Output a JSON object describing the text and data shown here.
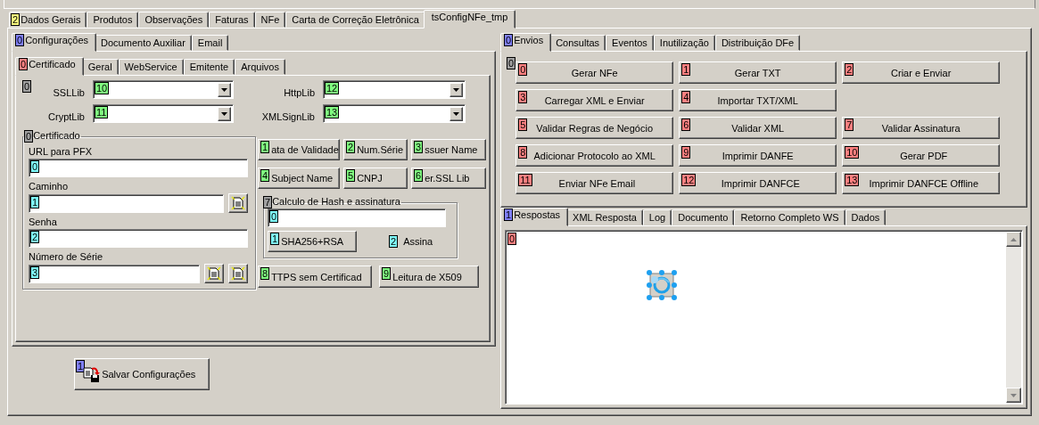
{
  "main_tabs": {
    "badge": {
      "text": "2",
      "color": "#ffff80"
    },
    "items": [
      {
        "label": "Dados Gerais",
        "selected": false
      },
      {
        "label": "Produtos",
        "selected": false
      },
      {
        "label": "Observações",
        "selected": false
      },
      {
        "label": "Faturas",
        "selected": false
      },
      {
        "label": "NFe",
        "selected": false
      },
      {
        "label": "Carta de Correção Eletrônica",
        "selected": false
      },
      {
        "label": "tsConfigNFe_tmp",
        "selected": true
      }
    ]
  },
  "config": {
    "tabs": {
      "badge": {
        "text": "0",
        "color": "#8080ff"
      },
      "items": [
        {
          "label": "Configurações",
          "selected": true
        },
        {
          "label": "Documento Auxiliar",
          "selected": false
        },
        {
          "label": "Email",
          "selected": false
        }
      ]
    },
    "sub_tabs": {
      "badge": {
        "text": "0",
        "color": "#ff8080"
      },
      "items": [
        {
          "label": "Certificado",
          "selected": true
        },
        {
          "label": "Geral",
          "selected": false
        },
        {
          "label": "WebService",
          "selected": false
        },
        {
          "label": "Emitente",
          "selected": false
        },
        {
          "label": "Arquivos",
          "selected": false
        }
      ]
    },
    "panel_badge": {
      "text": "0",
      "color": "#a0a0a0"
    },
    "libs": [
      {
        "label": "SSLLib",
        "badge": {
          "text": "10",
          "color": "#80ff80"
        }
      },
      {
        "label": "HttpLib",
        "badge": {
          "text": "12",
          "color": "#80ff80"
        }
      },
      {
        "label": "CryptLib",
        "badge": {
          "text": "11",
          "color": "#80ff80"
        }
      },
      {
        "label": "XMLSignLib",
        "badge": {
          "text": "13",
          "color": "#80ff80"
        }
      }
    ],
    "certificate": {
      "badge": {
        "text": "0",
        "color": "#a0a0a0"
      },
      "title": "Certificado",
      "fields": [
        {
          "label": "URL para PFX",
          "badge": {
            "text": "0",
            "color": "#80ffff"
          }
        },
        {
          "label": "Caminho",
          "badge": {
            "text": "1",
            "color": "#80ffff"
          },
          "actions": [
            {
              "kind": "browse"
            }
          ]
        },
        {
          "label": "Senha",
          "badge": {
            "text": "2",
            "color": "#80ffff"
          }
        },
        {
          "label": "Número de Série",
          "badge": {
            "text": "3",
            "color": "#80ffff"
          },
          "actions": [
            {
              "kind": "browse"
            },
            {
              "kind": "browse"
            }
          ]
        }
      ]
    },
    "cert_buttons": [
      [
        {
          "label": "ata de Validade",
          "badge": {
            "text": "1",
            "color": "#80ff80"
          }
        },
        {
          "label": "Num.Série",
          "badge": {
            "text": "2",
            "color": "#80ff80"
          }
        },
        {
          "label": "ssuer Name",
          "badge": {
            "text": "3",
            "color": "#80ff80"
          }
        }
      ],
      [
        {
          "label": "Subject Name",
          "badge": {
            "text": "4",
            "color": "#80ff80"
          }
        },
        {
          "label": "CNPJ",
          "badge": {
            "text": "5",
            "color": "#80ff80"
          }
        },
        {
          "label": "er.SSL Lib",
          "badge": {
            "text": "6",
            "color": "#80ff80"
          }
        }
      ]
    ],
    "hash": {
      "badge": {
        "text": "7",
        "color": "#a0a0a0"
      },
      "title": "Calculo de Hash e assinatura",
      "field_badge": {
        "text": "0",
        "color": "#80ffff"
      },
      "algorithm": {
        "label": "SHA256+RSA",
        "badge": {
          "text": "1",
          "color": "#80ffff"
        }
      },
      "sign": {
        "label": "Assina",
        "badge": {
          "text": "2",
          "color": "#80ffff"
        }
      }
    },
    "extra_buttons": [
      {
        "label": "TTPS sem Certificad",
        "badge": {
          "text": "8",
          "color": "#80ff80"
        }
      },
      {
        "label": "Leitura de X509",
        "badge": {
          "text": "9",
          "color": "#80ff80"
        }
      }
    ],
    "save_button": {
      "label": "Salvar Configurações",
      "badge": {
        "text": "1",
        "color": "#8080ff"
      }
    }
  },
  "actions": {
    "tabs": {
      "badge": {
        "text": "0",
        "color": "#8080ff"
      },
      "items": [
        {
          "label": "Envios",
          "selected": true
        },
        {
          "label": "Consultas",
          "selected": false
        },
        {
          "label": "Eventos",
          "selected": false
        },
        {
          "label": "Inutilização",
          "selected": false
        },
        {
          "label": "Distribuição DFe",
          "selected": false
        }
      ]
    },
    "panel_badge": {
      "text": "0",
      "color": "#a0a0a0"
    },
    "rows": [
      [
        {
          "label": "Gerar NFe",
          "badge": {
            "text": "0",
            "color": "#ff8080"
          }
        },
        {
          "label": "Gerar TXT",
          "badge": {
            "text": "1",
            "color": "#ff8080"
          }
        },
        {
          "label": "Criar e Enviar",
          "badge": {
            "text": "2",
            "color": "#ff8080"
          }
        }
      ],
      [
        {
          "label": "Carregar XML e Enviar",
          "badge": {
            "text": "3",
            "color": "#ff8080"
          }
        },
        {
          "label": "Importar TXT/XML",
          "badge": {
            "text": "4",
            "color": "#ff8080"
          }
        }
      ],
      [
        {
          "label": "Validar Regras de Negócio",
          "badge": {
            "text": "5",
            "color": "#ff8080"
          }
        },
        {
          "label": "Validar XML",
          "badge": {
            "text": "6",
            "color": "#ff8080"
          }
        },
        {
          "label": "Validar Assinatura",
          "badge": {
            "text": "7",
            "color": "#ff8080"
          }
        }
      ],
      [
        {
          "label": "Adicionar Protocolo ao XML",
          "badge": {
            "text": "8",
            "color": "#ff8080"
          }
        },
        {
          "label": "Imprimir DANFE",
          "badge": {
            "text": "9",
            "color": "#ff8080"
          }
        },
        {
          "label": "Gerar PDF",
          "badge": {
            "text": "10",
            "color": "#ff8080"
          }
        }
      ],
      [
        {
          "label": "Enviar NFe Email",
          "badge": {
            "text": "11",
            "color": "#ff8080"
          }
        },
        {
          "label": "Imprimir DANFCE",
          "badge": {
            "text": "12",
            "color": "#ff8080"
          }
        },
        {
          "label": "Imprimir DANFCE Offline",
          "badge": {
            "text": "13",
            "color": "#ff8080"
          }
        }
      ]
    ]
  },
  "results": {
    "tabs": {
      "badge": {
        "text": "1",
        "color": "#8080ff"
      },
      "items": [
        {
          "label": "Respostas",
          "selected": true
        },
        {
          "label": "XML Resposta",
          "selected": false
        },
        {
          "label": "Log",
          "selected": false
        },
        {
          "label": "Documento",
          "selected": false
        },
        {
          "label": "Retorno Completo WS",
          "selected": false
        },
        {
          "label": "Dados",
          "selected": false
        }
      ]
    },
    "memo": {
      "badge": {
        "text": "0",
        "color": "#ff8080"
      }
    }
  }
}
